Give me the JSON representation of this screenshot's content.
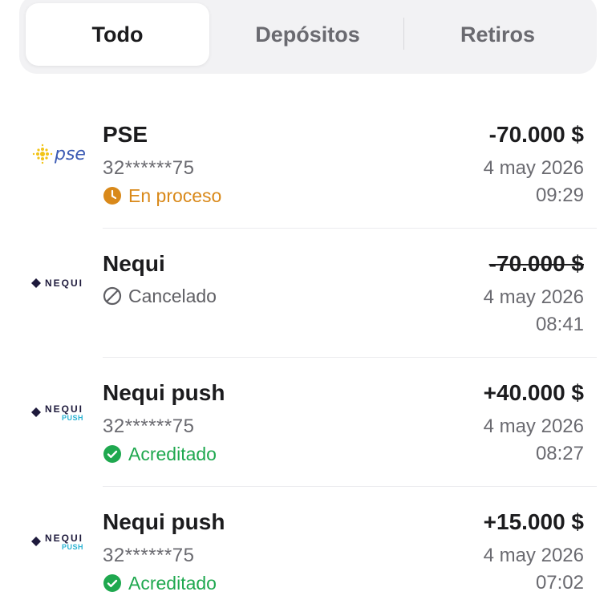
{
  "tabs": [
    {
      "label": "Todo",
      "active": true
    },
    {
      "label": "Depósitos",
      "active": false
    },
    {
      "label": "Retiros",
      "active": false
    }
  ],
  "transactions": [
    {
      "method": "PSE",
      "logo": "pse-logo",
      "account": "32******75",
      "status": "En proceso",
      "status_icon": "clock-icon",
      "amount": "-70.000 $",
      "date": "4 may 2026",
      "time": "09:29"
    },
    {
      "method": "Nequi",
      "logo": "nequi-logo",
      "status": "Cancelado",
      "status_icon": "cancel-icon",
      "amount": "-70.000 $",
      "date": "4 may 2026",
      "time": "08:41"
    },
    {
      "method": "Nequi push",
      "logo": "nequi-push-logo",
      "account": "32******75",
      "status": "Acreditado",
      "status_icon": "check-icon",
      "amount": "+40.000 $",
      "date": "4 may 2026",
      "time": "08:27"
    },
    {
      "method": "Nequi push",
      "logo": "nequi-push-logo",
      "account": "32******75",
      "status": "Acreditado",
      "status_icon": "check-icon",
      "amount": "+15.000 $",
      "date": "4 may 2026",
      "time": "07:02"
    }
  ],
  "logos": {
    "pse": "pse",
    "nequi": "NEQUI",
    "push": "PUSH"
  },
  "colors": {
    "in_process": "#d9891a",
    "cancelled": "#5f5f64",
    "credited": "#1fa84f",
    "tab_bg": "#f2f2f4"
  }
}
